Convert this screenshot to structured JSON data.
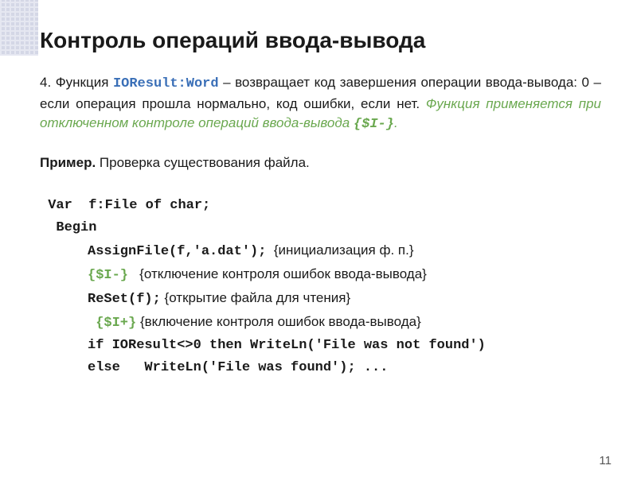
{
  "title": "Контроль операций ввода-вывода",
  "para": {
    "num": "4. Функция ",
    "func": "IOResult:Word",
    "text1": " – возвращает код завершения операции ввода-вывода: 0 – если операция прошла нормально, код ошибки, если нет. ",
    "italic": "Функция применяется при отключенном контроле операций ввода-вывода ",
    "dir": "{$I-}",
    "dot": "."
  },
  "example": {
    "label": "Пример.",
    "desc": " Проверка существования файла."
  },
  "code": {
    "l1a": " Var  f:",
    "l1b": "File of char",
    "l1c": ";",
    "l2": "  Begin",
    "l3a": "AssignFile(f,'a.dat');",
    "l3b": "  {инициализация ф. п.}",
    "l4a": "{$I-}",
    "l4b": "   {отключение контроля ошибок ввода-вывода}",
    "l5a": "ReSet(f);",
    "l5b": " {открытие файла для чтения}",
    "l6a": " {$I+}",
    "l6b": " {включение контроля ошибок ввода-вывода}",
    "l7": "if IOResult<>0 then WriteLn('File was not found')",
    "l8": "else   WriteLn('File was found'); ..."
  },
  "page": "11"
}
